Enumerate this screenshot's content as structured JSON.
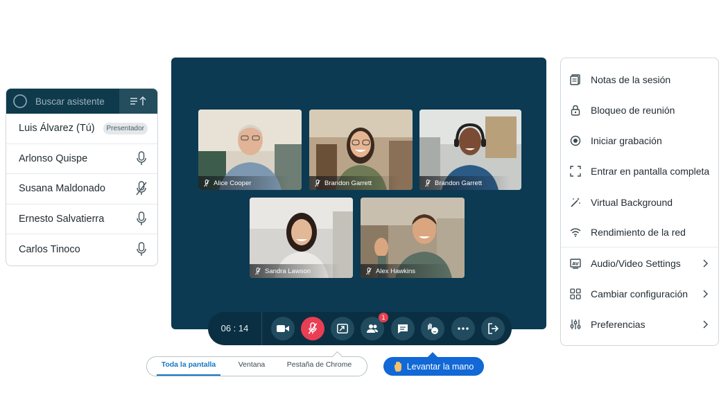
{
  "attendees": {
    "search_placeholder": "Buscar asistente",
    "list": [
      {
        "name": "Luis Álvarez (Tú)",
        "badge": "Presentador",
        "mic": "none"
      },
      {
        "name": "Arlonso Quispe",
        "mic": "on"
      },
      {
        "name": "Susana Maldonado",
        "mic": "muted"
      },
      {
        "name": "Ernesto Salvatierra",
        "mic": "on"
      },
      {
        "name": "Carlos Tinoco",
        "mic": "on"
      }
    ]
  },
  "video": {
    "tiles": [
      {
        "name": "Alice Cooper"
      },
      {
        "name": "Brandon Garrett"
      },
      {
        "name": "Brandon Garrett"
      },
      {
        "name": "Sandra Lawson"
      },
      {
        "name": "Alex Hawkins"
      }
    ]
  },
  "controls": {
    "timer": "06 : 14",
    "participants_badge": "1"
  },
  "share": {
    "options": [
      "Toda la pantalla",
      "Ventana",
      "Pestaña de Chrome"
    ],
    "active": "Toda la pantalla"
  },
  "raise_hand": {
    "label": "Levantar la mano"
  },
  "menu": {
    "items": [
      {
        "label": "Notas de la sesión",
        "icon": "notes-icon"
      },
      {
        "label": "Bloqueo de reunión",
        "icon": "lock-icon"
      },
      {
        "label": "Iniciar grabación",
        "icon": "record-icon"
      },
      {
        "label": "Entrar en pantalla completa",
        "icon": "fullscreen-icon"
      },
      {
        "label": "Virtual Background",
        "icon": "magic-wand-icon"
      },
      {
        "label": "Rendimiento de la red",
        "icon": "wifi-icon"
      },
      {
        "label": "Audio/Video Settings",
        "icon": "av-icon",
        "submenu": true
      },
      {
        "label": "Cambiar configuración",
        "icon": "grid-icon",
        "submenu": true
      },
      {
        "label": "Preferencias",
        "icon": "sliders-icon",
        "submenu": true
      }
    ]
  },
  "colors": {
    "stage": "#0b3a52",
    "control_bar": "#0b2f42",
    "mute_red": "#ea3e55",
    "accent_blue": "#1168d6",
    "panel_header": "#0e3a4c"
  }
}
